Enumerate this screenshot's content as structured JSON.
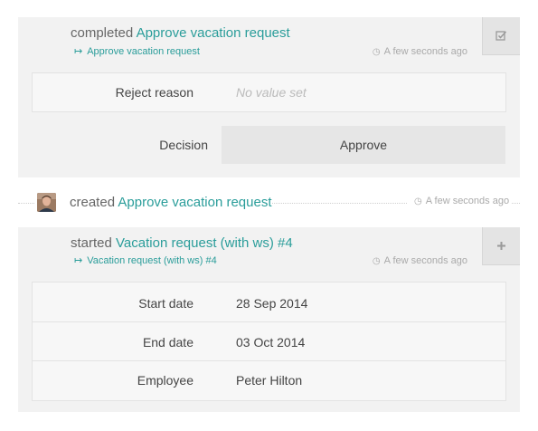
{
  "events": [
    {
      "action": "completed",
      "title": "Approve vacation request",
      "sublink": "Approve vacation request",
      "time": "A few seconds ago",
      "action_icon": "check-square-icon",
      "fields": [
        {
          "label": "Reject reason",
          "value": "No value set"
        }
      ],
      "decision_label": "Decision",
      "decision_button": "Approve"
    },
    {
      "action": "created",
      "title": "Approve vacation request",
      "time": "A few seconds ago"
    },
    {
      "action": "started",
      "title": "Vacation request (with ws) #4",
      "sublink": "Vacation request (with ws) #4",
      "time": "A few seconds ago",
      "action_icon": "plus-icon",
      "fields": [
        {
          "label": "Start date",
          "value": "28 Sep 2014"
        },
        {
          "label": "End date",
          "value": "03 Oct 2014"
        },
        {
          "label": "Employee",
          "value": "Peter Hilton"
        }
      ]
    }
  ],
  "colors": {
    "link": "#2a9d9a",
    "card_bg": "#f2f2f2",
    "muted": "#aaaaaa"
  },
  "icons": {
    "sublink": "forward-arrow-icon",
    "time": "clock-icon"
  }
}
